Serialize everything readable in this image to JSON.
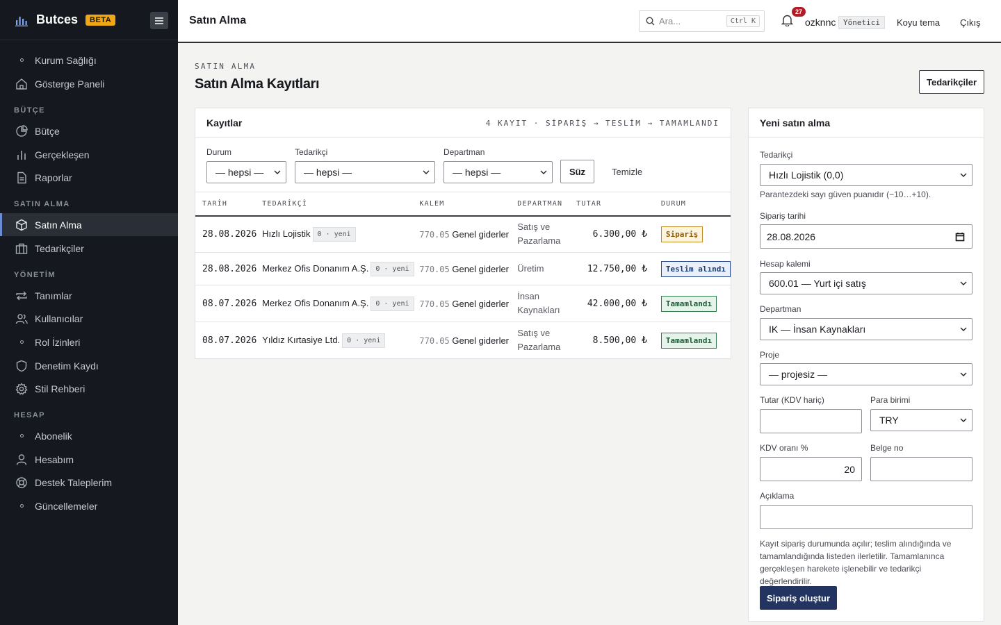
{
  "brand": {
    "name": "Butces",
    "badge": "BETA"
  },
  "sidebar": {
    "sections": {
      "budget": "BÜTÇE",
      "purchasing": "SATIN ALMA",
      "management": "YÖNETİM",
      "account": "HESAP"
    },
    "items": [
      "Kurum Sağlığı",
      "Gösterge Paneli",
      "Bütçe",
      "Gerçekleşen",
      "Raporlar",
      "Satın Alma",
      "Tedarikçiler",
      "Tanımlar",
      "Kullanıcılar",
      "Rol İzinleri",
      "Denetim Kaydı",
      "Stil Rehberi",
      "Abonelik",
      "Hesabım",
      "Destek Taleplerim",
      "Güncellemeler"
    ],
    "active": "Satın Alma"
  },
  "header": {
    "title": "Satın Alma",
    "search_placeholder": "Ara...",
    "search_shortcut": "Ctrl K",
    "notifications": "27",
    "user": "ozknnc",
    "role": "Yönetici",
    "theme": "Koyu tema",
    "logout": "Çıkış"
  },
  "page": {
    "breadcrumb": "SATIN ALMA",
    "title": "Satın Alma Kayıtları",
    "suppliers_button": "Tedarikçiler"
  },
  "records": {
    "title": "Kayıtlar",
    "meta": "4 KAYIT · SİPARİŞ → TESLİM → TAMAMLANDI",
    "filters": {
      "status_label": "Durum",
      "status_value": "— hepsi —",
      "supplier_label": "Tedarikçi",
      "supplier_value": "— hepsi —",
      "dept_label": "Departman",
      "dept_value": "— hepsi —",
      "apply": "Süz",
      "clear": "Temizle"
    },
    "columns": [
      "TARİH",
      "TEDARİKÇİ",
      "KALEM",
      "DEPARTMAN",
      "TUTAR",
      "DURUM"
    ],
    "rows": [
      {
        "date": "28.08.2026",
        "supplier": "Hızlı Lojistik",
        "chip": "0 · yeni",
        "code": "770.05",
        "item": "Genel giderler",
        "dept1": "Satış ve",
        "dept2": "Pazarlama",
        "amount": "6.300,00 ₺",
        "status": "Sipariş",
        "kind": "order"
      },
      {
        "date": "28.08.2026",
        "supplier": "Merkez Ofis Donanım A.Ş.",
        "chip": "0 · yeni",
        "code": "770.05",
        "item": "Genel giderler",
        "dept1": "Üretim",
        "dept2": "",
        "amount": "12.750,00 ₺",
        "status": "Teslim alındı",
        "kind": "recv"
      },
      {
        "date": "08.07.2026",
        "supplier": "Merkez Ofis Donanım A.Ş.",
        "chip": "0 · yeni",
        "code": "770.05",
        "item": "Genel giderler",
        "dept1": "İnsan",
        "dept2": "Kaynakları",
        "amount": "42.000,00 ₺",
        "status": "Tamamlandı",
        "kind": "done"
      },
      {
        "date": "08.07.2026",
        "supplier": "Yıldız Kırtasiye Ltd.",
        "chip": "0 · yeni",
        "code": "770.05",
        "item": "Genel giderler",
        "dept1": "Satış ve",
        "dept2": "Pazarlama",
        "amount": "8.500,00 ₺",
        "status": "Tamamlandı",
        "kind": "done"
      }
    ]
  },
  "form": {
    "title": "Yeni satın alma",
    "supplier_label": "Tedarikçi",
    "supplier_value": "Hızlı Lojistik (0,0)",
    "supplier_hint": "Parantezdeki sayı güven puanıdır (−10…+10).",
    "date_label": "Sipariş tarihi",
    "date_value": "28.08.2026",
    "account_label": "Hesap kalemi",
    "account_value": "600.01 — Yurt içi satış",
    "dept_label": "Departman",
    "dept_value": "IK — İnsan Kaynakları",
    "project_label": "Proje",
    "project_value": "— projesiz —",
    "amount_label": "Tutar (KDV hariç)",
    "amount_value": "",
    "currency_label": "Para birimi",
    "currency_value": "TRY",
    "vat_label": "KDV oranı %",
    "vat_value": "20",
    "doc_label": "Belge no",
    "doc_value": "",
    "desc_label": "Açıklama",
    "desc_value": "",
    "note1": "Kayıt sipariş durumunda açılır; teslim alındığında ve",
    "note2": "tamamlandığında listeden ilerletilir. Tamamlanınca",
    "note3": "gerçekleşen harekete işlenebilir ve tedarikçi değerlendirilir.",
    "submit": "Sipariş oluştur"
  }
}
